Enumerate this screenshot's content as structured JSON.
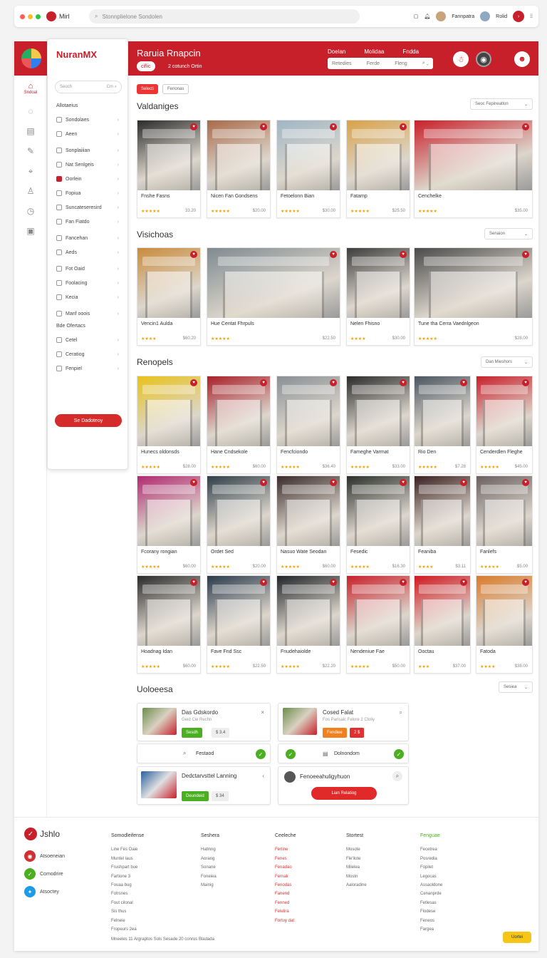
{
  "browser": {
    "tab_title": "Mirl",
    "address": "Stonnplielone Sondolen",
    "user1": "Fannpatra",
    "user2": "Rolid"
  },
  "header": {
    "title": "Raruia Rnapcin",
    "pill1": "ciflic",
    "pill2": "2 cotunch Ortin",
    "nav": [
      "Doelan",
      "Molidaa",
      "Fndda"
    ],
    "search_label": "Retedies",
    "search_mid": "Ferde",
    "search_end": "Fleng"
  },
  "sidebar": {
    "logo": "NuranMX",
    "rail_label": "Sndoal",
    "search": "Seoch",
    "search_right": "Cm",
    "section1": "Allotaeius",
    "section2": "Bde Ofertacs",
    "button": "Se Dadoteoy",
    "items": [
      {
        "label": "Sondolaes"
      },
      {
        "label": "Aeen"
      },
      {
        "label": "Sonplaiiian"
      },
      {
        "label": "Nat Senlgeis"
      },
      {
        "label": "Oorlein"
      },
      {
        "label": "Fopiua"
      },
      {
        "label": "Suncateseresird"
      },
      {
        "label": "Fan Fiatdo"
      },
      {
        "label": "Fancehan"
      },
      {
        "label": "Aeds"
      },
      {
        "label": "Fot Oaid"
      },
      {
        "label": "Foolacing"
      },
      {
        "label": "Kecia"
      },
      {
        "label": "Manf ooois"
      },
      {
        "label": "Cetel"
      },
      {
        "label": "Ceratiog"
      },
      {
        "label": "Fenpiel"
      }
    ]
  },
  "chips": [
    "Selecti",
    "Fenonas"
  ],
  "sections": {
    "s1": {
      "title": "Valdaniges",
      "sort": "Seoc Fepineatlon"
    },
    "s2": {
      "title": "Visichoas",
      "sort": "Senaion"
    },
    "s3": {
      "title": "Renopels",
      "sort": "Dan Mieshors"
    },
    "s4": {
      "title": "Uoloeesa",
      "sort": "Sesiea"
    }
  },
  "cards1": [
    {
      "name": "Fnshe Fasns",
      "stars": "★★★★★",
      "price": "33.20",
      "color": "#2b2b2b"
    },
    {
      "name": "Nicen Fan Gondsens",
      "stars": "★★★★★",
      "price": "$20.00",
      "color": "#a86a4a"
    },
    {
      "name": "Fetoelonn Bian",
      "stars": "★★★★★",
      "price": "$30.00",
      "color": "#9fb6c4"
    },
    {
      "name": "Fatamp",
      "stars": "★★★★★",
      "price": "$25.50",
      "color": "#d8a24a"
    },
    {
      "name": "Cenchelke",
      "stars": "★★★★★",
      "price": "$35.00",
      "color": "#c8202a"
    }
  ],
  "cards2": [
    {
      "name": "Vencin1 Aulda",
      "stars": "★★★★",
      "price": "$60.20",
      "color": "#c98a3a"
    },
    {
      "name": "Hue Centat Fhrpuls",
      "stars": "★★★★★",
      "price": "$22.50",
      "color": "#7f8a90"
    },
    {
      "name": "Nelen Fhisno",
      "stars": "★★★★",
      "price": "$30.00",
      "color": "#3c3c3c"
    },
    {
      "name": "Tune tha Cerra Vaednlgeon",
      "stars": "★★★★★",
      "price": "$28.00",
      "color": "#4a4a4a"
    }
  ],
  "cards3": [
    {
      "name": "Hunecs oldonsds",
      "stars": "★★★★★",
      "price": "$28.00",
      "color": "#e8c21a"
    },
    {
      "name": "Hane Cndsekole",
      "stars": "★★★★★",
      "price": "$60.00",
      "color": "#a8202a"
    },
    {
      "name": "Fencfciondo",
      "stars": "★★★★★",
      "price": "$36.40",
      "color": "#8a8f94"
    },
    {
      "name": "Fameghe Varmat",
      "stars": "★★★★★",
      "price": "$33.00",
      "color": "#2a2a2a"
    },
    {
      "name": "Rio Den",
      "stars": "★★★★★",
      "price": "$7.28",
      "color": "#4a5560"
    },
    {
      "name": "Cenderdlen Fleghe",
      "stars": "★★★★★",
      "price": "$45.00",
      "color": "#c8202a"
    },
    {
      "name": "Fcorany rongian",
      "stars": "★★★★★",
      "price": "$60.00",
      "color": "#b02a70"
    },
    {
      "name": "Ordet Sed",
      "stars": "★★★★★",
      "price": "$20.00",
      "color": "#2f3e48"
    },
    {
      "name": "Nasuo Wate Seodan",
      "stars": "★★★★★",
      "price": "$60.00",
      "color": "#3a2a2a"
    },
    {
      "name": "Fesedic",
      "stars": "★★★★★",
      "price": "$16.30",
      "color": "#2a2f2a"
    },
    {
      "name": "Feaniba",
      "stars": "★★★★",
      "price": "$3.11",
      "color": "#3a2020"
    },
    {
      "name": "Fanlefs",
      "stars": "★★★★★",
      "price": "$5.00",
      "color": "#6a6060"
    },
    {
      "name": "Hoadnag Idan",
      "stars": "★★★★★",
      "price": "$60.00",
      "color": "#2a2a2a"
    },
    {
      "name": "Fave Fnd Ssc",
      "stars": "★★★★★",
      "price": "$22.50",
      "color": "#2a3a4a"
    },
    {
      "name": "Fnudehaiolde",
      "stars": "★★★★★",
      "price": "$22.20",
      "color": "#202428"
    },
    {
      "name": "Nendeniue Fae",
      "stars": "★★★★★",
      "price": "$50.00",
      "color": "#c8202a"
    },
    {
      "name": "Ooctau",
      "stars": "★★★",
      "price": "$37.00",
      "color": "#d01820"
    },
    {
      "name": "Fatoda",
      "stars": "★★★★",
      "price": "$38.00",
      "color": "#d97a2a"
    }
  ],
  "suggest": {
    "a": {
      "title": "Das Gdskordo",
      "sub": "Geid Cie Rechn",
      "btn": "Sesdh",
      "btn2": "$ 3.4"
    },
    "b": {
      "title": "Cosed Falat",
      "sub": "Fos Parisalc Felore 2 Cloliy",
      "btn": "Fendiee",
      "btn2": "2 $"
    },
    "c": {
      "label": "Festaod"
    },
    "d": {
      "label": "Dolnondom"
    },
    "e": {
      "title": "Dedctarvsttel Lanning",
      "sub": "",
      "btn": "Deundeid",
      "btn2": "$ 34"
    },
    "f": {
      "title": "Fenoeeahuligyhuon",
      "btn": "Lian Relatiog"
    }
  },
  "footer": {
    "logo": "Jshlo",
    "social": [
      "Atsoeneian",
      "Comodrire",
      "Atsoctey"
    ],
    "col1": {
      "h": "Somodleifense",
      "items": [
        "Line Fes Oaie",
        "Muntel laus",
        "Frushpart bue",
        "Fartione 3",
        "Fouaa bug",
        "Fotrsnes",
        "Fout cilonal",
        "Sis thus",
        "Felneie",
        "Fropeurs 2ea"
      ]
    },
    "col2": {
      "h": "Seshera",
      "items": [
        "Hatlnng",
        "Aorang",
        "Sonane",
        "Foneiea",
        "Mainig"
      ]
    },
    "col3": {
      "h": "Ceeleche",
      "items": [
        "Ferline",
        "Fenes",
        "Fenadao",
        "Fernak",
        "Fenodas",
        "Fanend",
        "Fenned",
        "Felelira",
        "Fortuy dat"
      ]
    },
    "col4": {
      "h": "Stortest",
      "items": [
        "Mosote",
        "Fle'ilote",
        "Milelea",
        "Mostn",
        "Aaloradine"
      ]
    },
    "col5": {
      "h": "Fenguae",
      "items": [
        "Fecetrea",
        "Posredia",
        "Fopilet",
        "Legocas",
        "Assaoldone",
        "Cenanprde",
        "Fetlesas",
        "Flodese",
        "Feneos",
        "Fargea"
      ]
    },
    "copyright": "Mneeles 11 Argraptos Sols Sesade 20 conrus Bladada",
    "cta": "Uortei"
  }
}
